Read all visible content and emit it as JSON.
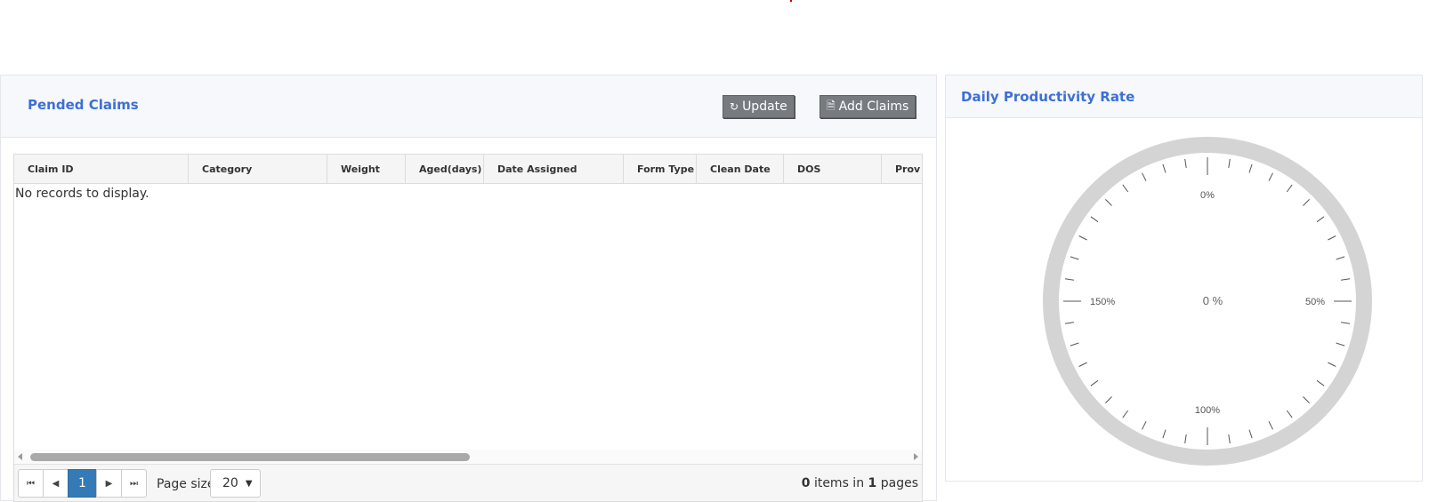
{
  "claims": {
    "title": "Pended Claims",
    "update_label": "Update",
    "add_label": "Add Claims",
    "columns": [
      "Claim ID",
      "Category",
      "Weight",
      "Aged(days)",
      "Date Assigned",
      "Form Type",
      "Clean Date",
      "DOS",
      "Prov"
    ],
    "empty_message": "No records to display.",
    "pager": {
      "current_page": "1",
      "page_size_label": "Page size:",
      "page_size": "20",
      "items": "0",
      "items_text": "items in",
      "pages": "1",
      "pages_text": "pages"
    }
  },
  "productivity": {
    "title": "Daily Productivity Rate",
    "gauge": {
      "value_label": "0 %",
      "tick_labels": [
        "0%",
        "50%",
        "100%",
        "150%"
      ],
      "value_percent": 0,
      "max_percent": 200
    }
  },
  "colors": {
    "title_blue": "#3d6fd6",
    "button_gray": "#777b80",
    "pager_active": "#337ab7",
    "gauge_ring": "#d4d4d4"
  }
}
